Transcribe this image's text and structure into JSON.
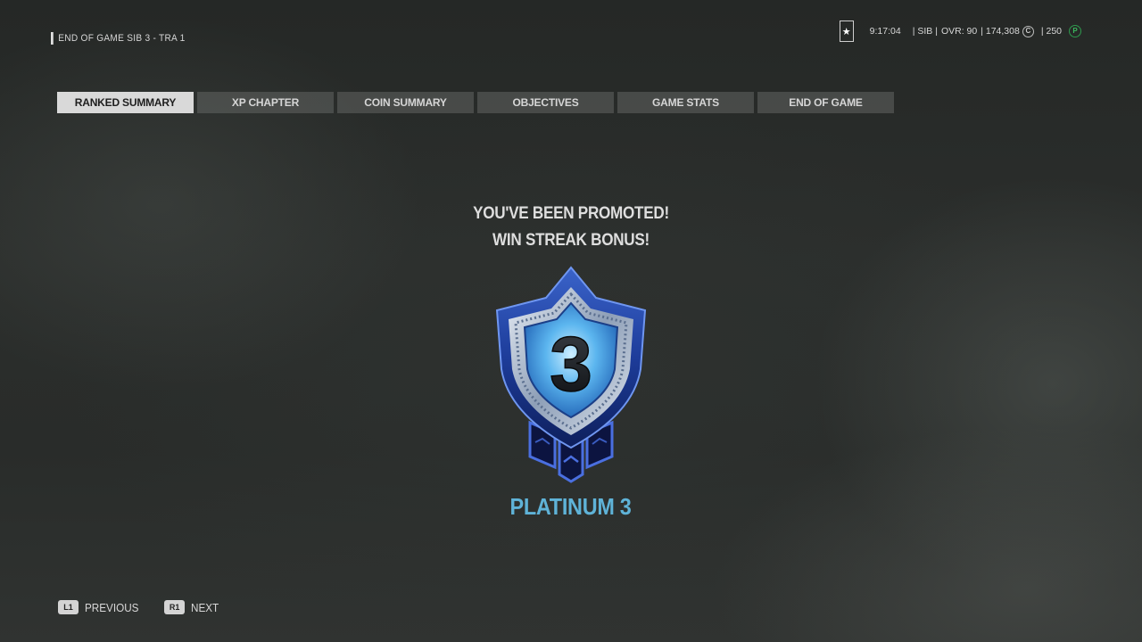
{
  "header": {
    "mode_title": "END OF GAME SIB 3 - TRA 1"
  },
  "player": {
    "rank_icon": "star-icon",
    "rank_glyph": "★",
    "time": "9:17:04",
    "tag": "| SIB |",
    "ovr": "OVR: 90",
    "coins": "| 174,308",
    "coin_icon": "coin-icon",
    "coin_glyph": "C",
    "points": "| 250",
    "points_icon": "points-icon",
    "points_glyph": "P",
    "points_color": "#2f9a4e"
  },
  "tabs": [
    {
      "label": "RANKED SUMMARY",
      "active": true
    },
    {
      "label": "XP CHAPTER",
      "active": false
    },
    {
      "label": "COIN SUMMARY",
      "active": false
    },
    {
      "label": "OBJECTIVES",
      "active": false
    },
    {
      "label": "GAME STATS",
      "active": false
    },
    {
      "label": "END OF GAME",
      "active": false
    }
  ],
  "promotion": {
    "line1": "YOU'VE BEEN PROMOTED!",
    "line2": "WIN STREAK BONUS!",
    "badge_number": "3",
    "badge_icon": "platinum-rank-badge-icon",
    "rank_name": "PLATINUM 3",
    "rank_color": "#5fb3d8"
  },
  "nav": {
    "previous_key": "L1",
    "previous_label": "PREVIOUS",
    "next_key": "R1",
    "next_label": "NEXT"
  }
}
